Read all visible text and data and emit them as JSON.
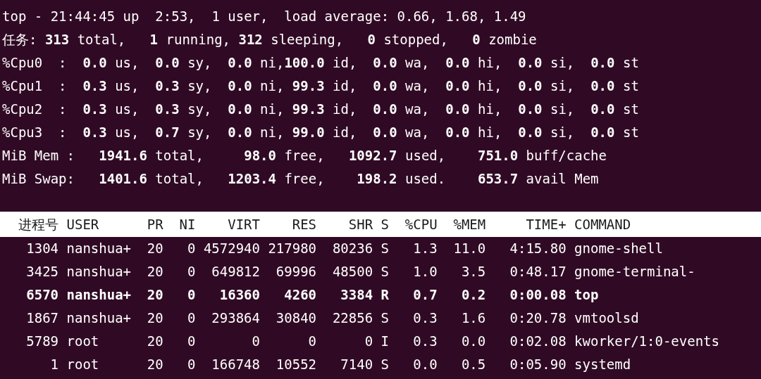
{
  "summary_lines": [
    "top - 21:44:45 up  2:53,  1 user,  load average: 0.66, 1.68, 1.49",
    "任务: **313** total,   **1** running, **312** sleeping,   **0** stopped,   **0** zombie",
    "%Cpu0  :  **0.0** us,  **0.0** sy,  **0.0** ni,**100.0** id,  **0.0** wa,  **0.0** hi,  **0.0** si,  **0.0** st",
    "%Cpu1  :  **0.3** us,  **0.3** sy,  **0.0** ni, **99.3** id,  **0.0** wa,  **0.0** hi,  **0.0** si,  **0.0** st",
    "%Cpu2  :  **0.3** us,  **0.3** sy,  **0.0** ni, **99.3** id,  **0.0** wa,  **0.0** hi,  **0.0** si,  **0.0** st",
    "%Cpu3  :  **0.3** us,  **0.7** sy,  **0.0** ni, **99.0** id,  **0.0** wa,  **0.0** hi,  **0.0** si,  **0.0** st",
    "MiB Mem :   **1941.6** total,     **98.0** free,   **1092.7** used,    **751.0** buff/cache",
    "MiB Swap:   **1401.6** total,   **1203.4** free,    **198.2** used.    **653.7** avail Mem"
  ],
  "process_table": {
    "columns": [
      "进程号",
      "USER",
      "PR",
      "NI",
      "VIRT",
      "RES",
      "SHR",
      "S",
      "%CPU",
      "%MEM",
      "TIME+",
      "COMMAND"
    ],
    "rows": [
      {
        "bold": false,
        "cells": [
          "1304",
          "nanshua+",
          "20",
          "0",
          "4572940",
          "217980",
          "80236",
          "S",
          "1.3",
          "11.0",
          "4:15.80",
          "gnome-shell"
        ]
      },
      {
        "bold": false,
        "cells": [
          "3425",
          "nanshua+",
          "20",
          "0",
          "649812",
          "69996",
          "48500",
          "S",
          "1.0",
          "3.5",
          "0:48.17",
          "gnome-terminal-"
        ]
      },
      {
        "bold": true,
        "cells": [
          "6570",
          "nanshua+",
          "20",
          "0",
          "16360",
          "4260",
          "3384",
          "R",
          "0.7",
          "0.2",
          "0:00.08",
          "top"
        ]
      },
      {
        "bold": false,
        "cells": [
          "1867",
          "nanshua+",
          "20",
          "0",
          "293864",
          "30840",
          "22856",
          "S",
          "0.3",
          "1.6",
          "0:20.78",
          "vmtoolsd"
        ]
      },
      {
        "bold": false,
        "cells": [
          "5789",
          "root",
          "20",
          "0",
          "0",
          "0",
          "0",
          "I",
          "0.3",
          "0.0",
          "0:02.08",
          "kworker/1:0-events"
        ]
      },
      {
        "bold": false,
        "cells": [
          "1",
          "root",
          "20",
          "0",
          "166748",
          "10552",
          "7140",
          "S",
          "0.0",
          "0.5",
          "0:05.90",
          "systemd"
        ]
      }
    ]
  }
}
